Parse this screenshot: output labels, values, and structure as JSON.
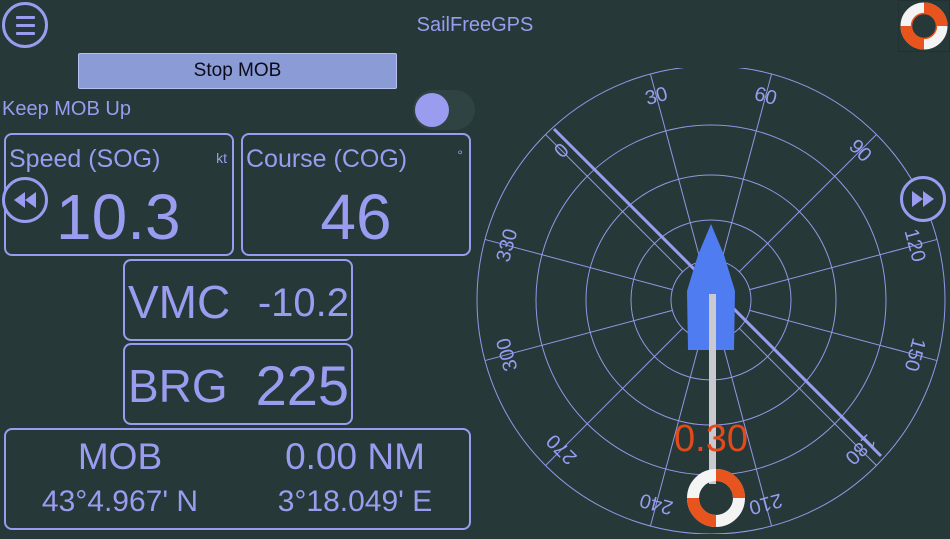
{
  "app": {
    "title": "SailFreeGPS"
  },
  "toolbar": {
    "stop_mob_label": "Stop MOB"
  },
  "settings": {
    "keep_mob_label": "Keep MOB Up"
  },
  "speed": {
    "label": "Speed (SOG)",
    "unit": "kt",
    "value": "10.3"
  },
  "course": {
    "label": "Course (COG)",
    "unit": "°",
    "value": "46"
  },
  "vmc": {
    "label": "VMC",
    "value": "-10.2"
  },
  "brg": {
    "label": "BRG",
    "value": "225"
  },
  "mob": {
    "label": "MOB",
    "distance": "0.00 NM",
    "lat": "43°4.967' N",
    "lon": "3°18.049' E"
  },
  "compass": {
    "ring_labels": [
      "0",
      "30",
      "60",
      "90",
      "120",
      "150",
      "180",
      "210",
      "240",
      "270",
      "300",
      "330"
    ],
    "mob_distance": "0.30",
    "course_line": "#9a9cf0",
    "boat_color": "#4f7cf0"
  },
  "icons": {
    "menu": "menu-icon",
    "lifebuoy": "lifebuoy-icon",
    "prev": "rewind-icon",
    "next": "fast-forward-icon"
  },
  "colors": {
    "accent": "#9a9cf0",
    "background": "#263838",
    "mob_distance": "#e34a1a",
    "stop_button": "#8a9bd6"
  }
}
